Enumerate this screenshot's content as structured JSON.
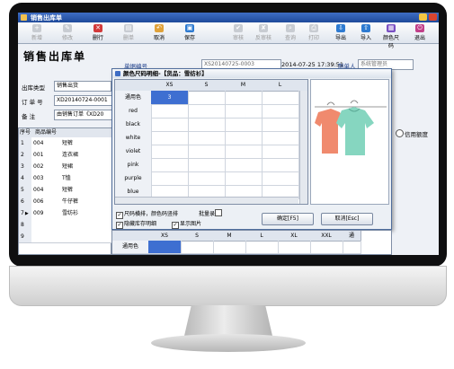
{
  "window": {
    "title": "销售出库单"
  },
  "toolbar": [
    {
      "name": "new-button",
      "label": "新增",
      "icon": "+",
      "color": "#9aa4b0",
      "enabled": false
    },
    {
      "name": "edit-button",
      "label": "修改",
      "icon": "✎",
      "color": "#9aa4b0",
      "enabled": false
    },
    {
      "name": "delete-row-button",
      "label": "删行",
      "icon": "✕",
      "color": "#d23a3a",
      "enabled": true
    },
    {
      "name": "delete-doc-button",
      "label": "删单",
      "icon": "▤",
      "color": "#9aa4b0",
      "enabled": false
    },
    {
      "name": "cancel-button",
      "label": "取消",
      "icon": "↶",
      "color": "#e0a23a",
      "enabled": true
    },
    {
      "name": "save-button",
      "label": "保存",
      "icon": "▣",
      "color": "#2e7bd1",
      "enabled": true
    },
    {
      "name": "audit-button",
      "label": "审核",
      "icon": "✔",
      "color": "#9aa4b0",
      "enabled": false
    },
    {
      "name": "unaudit-button",
      "label": "反审核",
      "icon": "✘",
      "color": "#9aa4b0",
      "enabled": false
    },
    {
      "name": "query-button",
      "label": "查询",
      "icon": "⌕",
      "color": "#9aa4b0",
      "enabled": false
    },
    {
      "name": "print-button",
      "label": "打印",
      "icon": "⎙",
      "color": "#9aa4b0",
      "enabled": false
    },
    {
      "name": "export-button",
      "label": "导出",
      "icon": "⇩",
      "color": "#2e7bd1",
      "enabled": true
    },
    {
      "name": "import-button",
      "label": "导入",
      "icon": "⇧",
      "color": "#2e7bd1",
      "enabled": true
    },
    {
      "name": "color-size-button",
      "label": "颜色尺码",
      "icon": "▦",
      "color": "#7a4fc2",
      "enabled": true
    },
    {
      "name": "exit-button",
      "label": "退出",
      "icon": "⏻",
      "color": "#c2408a",
      "enabled": true
    }
  ],
  "form": {
    "heading": "销售出库单",
    "doc_no_label": "单据编号",
    "doc_no": "XS20140725-0003",
    "date": "2014-07-25  17:39:51",
    "maker_label": "制单人",
    "maker": "系统管理员",
    "out_type_label": "出库类型",
    "out_type": "销售出货",
    "order_no_label": "订 单 号",
    "order_no": "XD20140724-0001",
    "remark_label": "备   注",
    "remark": "由销售订单《XD20",
    "credit_label": "信用额度"
  },
  "detail": {
    "columns": [
      "序号",
      "商品编号",
      ""
    ],
    "rows": [
      [
        "1",
        "004",
        "短裤"
      ],
      [
        "2",
        "001",
        "连衣裙"
      ],
      [
        "3",
        "002",
        "短裙"
      ],
      [
        "4",
        "003",
        "T恤"
      ],
      [
        "5",
        "004",
        "短裤"
      ],
      [
        "6",
        "006",
        "牛仔裤"
      ],
      [
        "7",
        "009",
        "雪纺衫"
      ],
      [
        "8",
        "",
        ""
      ],
      [
        "9",
        "",
        ""
      ]
    ],
    "current_row": 6
  },
  "popup": {
    "title": "颜色尺码明细-【货品：雪纺衫】",
    "size_headers": [
      "XS",
      "S",
      "M",
      "L"
    ],
    "colors": [
      "通用色",
      "red",
      "black",
      "white",
      "violet",
      "pink",
      "purple",
      "blue"
    ],
    "quantities": [
      [
        "3",
        "",
        "",
        ""
      ]
    ],
    "checkbox_size_layout": "尺码横排，颜色码竖排",
    "checkbox_batch_entry": "批量录",
    "checkbox_hide_stock": "隐藏库存明细",
    "checkbox_show_image": "显示图片",
    "ok_label": "确定[F5]",
    "cancel_label": "取消[Esc]",
    "image_alt": "雪纺衫 product photo: two chiffon blouses (coral and mint) on hangers",
    "coral_color": "#f08a6e",
    "mint_color": "#86d6c0"
  },
  "stock_grid": {
    "headers": [
      "",
      "XS",
      "S",
      "M",
      "L",
      "XL",
      "XXL",
      "通"
    ],
    "rows": [
      [
        "通用色",
        "",
        "",
        "",
        "",
        "",
        "",
        ""
      ]
    ]
  }
}
